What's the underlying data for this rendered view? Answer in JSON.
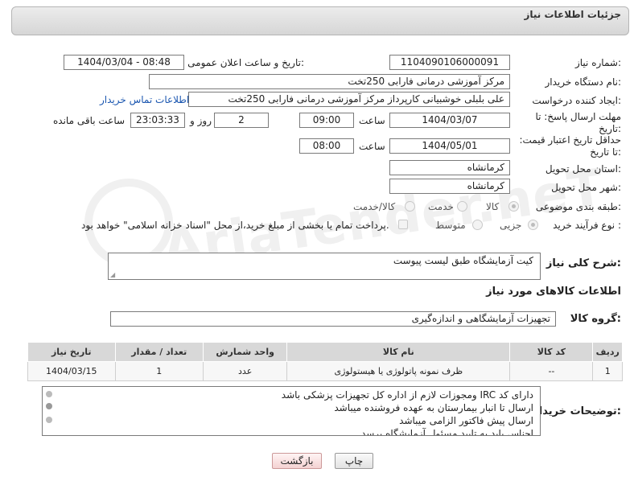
{
  "header": {
    "title": "جزئیات اطلاعات نیاز"
  },
  "fields": {
    "need_number_label": "شماره نیاز:",
    "need_number": "1104090106000091",
    "announce_label": "تاریخ و ساعت اعلان عمومی:",
    "announce_value": "1404/03/04 - 08:48",
    "buyer_label": "نام دستگاه خریدار:",
    "buyer_value": "مرکز آموزشی  درمانی فارابی 250تخت",
    "creator_label": "ایجاد کننده درخواست:",
    "creator_value": "علی بلبلی خوشبیانی کارپرداز مرکز آموزشی  درمانی فارابی 250تخت",
    "contact_link": "اطلاعات تماس خریدار",
    "deadline_label": "مهلت ارسال پاسخ: تا تاریخ:",
    "deadline_date": "1404/03/07",
    "time_label": "ساعت",
    "deadline_time": "09:00",
    "days_value": "2",
    "days_label": "روز و",
    "remaining_time": "23:03:33",
    "remaining_label": "ساعت باقی مانده",
    "validity_label": "حداقل تاریخ اعتبار قیمت: تا تاریخ:",
    "validity_date": "1404/05/01",
    "validity_time": "08:00",
    "province_label": "استان محل تحویل:",
    "province_value": "کرمانشاه",
    "city_label": "شهر محل تحویل:",
    "city_value": "کرمانشاه",
    "category_label": "طبقه بندی موضوعی:",
    "category_options": [
      "کالا",
      "خدمت",
      "کالا/خدمت"
    ],
    "process_label": "نوع فرآیند خرید :",
    "process_options": [
      "جزیی",
      "متوسط"
    ],
    "process_note": "پرداخت تمام یا بخشی از مبلغ خرید،از محل \"اسناد خزانه اسلامی\" خواهد بود."
  },
  "description": {
    "label": "شرح کلی نیاز:",
    "value": "کیت آزمایشگاه طبق لیست پیوست"
  },
  "goods_section_title": "اطلاعات کالاهای مورد نیاز",
  "group": {
    "label": "گروه کالا:",
    "value": "تجهیزات آزمایشگاهی و اندازه‌گیری"
  },
  "table": {
    "headers": [
      "ردیف",
      "کد کالا",
      "نام کالا",
      "واحد شمارش",
      "تعداد / مقدار",
      "تاریخ نیاز"
    ],
    "rows": [
      [
        "1",
        "--",
        "ظرف نمونه پاتولوژی یا هیستولوژی",
        "عدد",
        "1",
        "1404/03/15"
      ]
    ]
  },
  "notes": {
    "label": "توضیحات خریدار:",
    "lines": [
      "دارای کد IRC ومجوزات لازم از اداره کل تجهیزات پزشکی باشد",
      "ارسال تا انبار بیمارستان به عهده فروشنده میباشد",
      "ارسال پیش فاکتور الزامی میباشد",
      "اجناس باید به تایید مسئول آزمایشگاه  برسد"
    ]
  },
  "buttons": {
    "print": "چاپ",
    "back": "بازگشت"
  },
  "watermark": "AriaTender.neT"
}
